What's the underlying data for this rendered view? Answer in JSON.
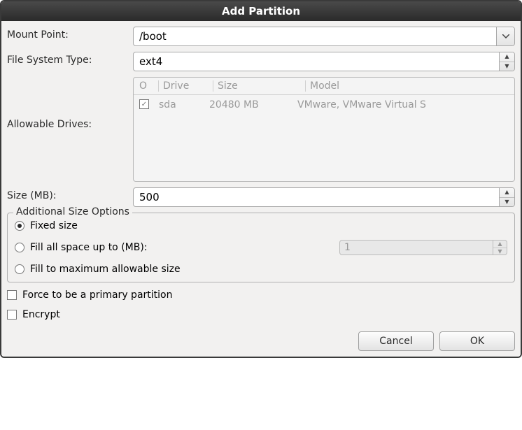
{
  "title": "Add Partition",
  "labels": {
    "mount_point": "Mount Point:",
    "fs_type": "File System Type:",
    "allowable_drives": "Allowable Drives:",
    "size": "Size (MB):"
  },
  "mount_point": {
    "value": "/boot"
  },
  "fs_type": {
    "value": "ext4"
  },
  "drives": {
    "headers": {
      "check": "O",
      "drive": "Drive",
      "size": "Size",
      "model": "Model"
    },
    "rows": [
      {
        "checked": true,
        "drive": "sda",
        "size": "20480 MB",
        "model": "VMware, VMware Virtual S"
      }
    ]
  },
  "size_mb": {
    "value": "500"
  },
  "additional": {
    "legend": "Additional Size Options",
    "fixed": "Fixed size",
    "fill_up_to": "Fill all space up to (MB):",
    "fill_up_to_value": "1",
    "fill_max": "Fill to maximum allowable size",
    "selected": "fixed"
  },
  "force_primary": {
    "label": "Force to be a primary partition",
    "checked": false
  },
  "encrypt": {
    "label": "Encrypt",
    "checked": false
  },
  "buttons": {
    "cancel": "Cancel",
    "ok": "OK"
  }
}
